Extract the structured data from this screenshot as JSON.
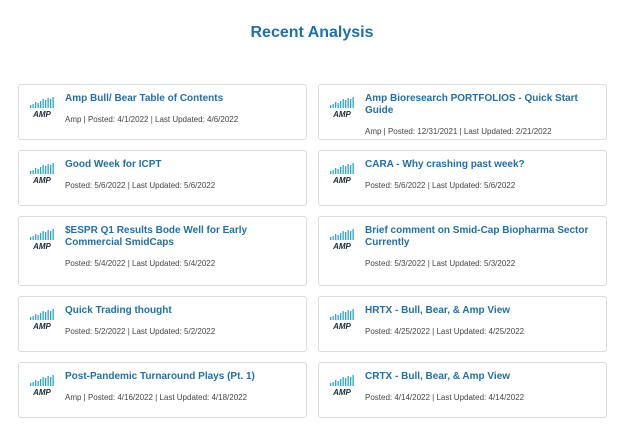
{
  "page": {
    "title": "Recent Analysis"
  },
  "logo": {
    "text": "AMP"
  },
  "cards": [
    {
      "title": "Amp Bull/ Bear Table of Contents",
      "meta": "Amp | Posted: 4/1/2022 | Last Updated: 4/6/2022"
    },
    {
      "title": "Amp Bioresearch PORTFOLIOS - Quick Start Guide",
      "meta": "Amp | Posted: 12/31/2021 | Last Updated: 2/21/2022"
    },
    {
      "title": "Good Week for ICPT",
      "meta": "Posted: 5/6/2022 | Last Updated: 5/6/2022"
    },
    {
      "title": "CARA - Why crashing past week?",
      "meta": "Posted: 5/6/2022 | Last Updated: 5/6/2022"
    },
    {
      "title": "$ESPR Q1 Results Bode Well for Early Commercial SmidCaps",
      "meta": "Posted: 5/4/2022 | Last Updated: 5/4/2022"
    },
    {
      "title": "Brief comment on Smid-Cap Biopharma Sector Currently",
      "meta": "Posted: 5/3/2022 | Last Updated: 5/3/2022"
    },
    {
      "title": "Quick Trading thought",
      "meta": "Posted: 5/2/2022 | Last Updated: 5/2/2022"
    },
    {
      "title": "HRTX - Bull, Bear, & Amp View",
      "meta": "Posted: 4/25/2022 | Last Updated: 4/25/2022"
    },
    {
      "title": "Post-Pandemic Turnaround Plays (Pt. 1)",
      "meta": "Amp | Posted: 4/16/2022 | Last Updated: 4/18/2022"
    },
    {
      "title": "CRTX - Bull, Bear, & Amp View",
      "meta": "Posted: 4/14/2022 | Last Updated: 4/14/2022"
    }
  ]
}
